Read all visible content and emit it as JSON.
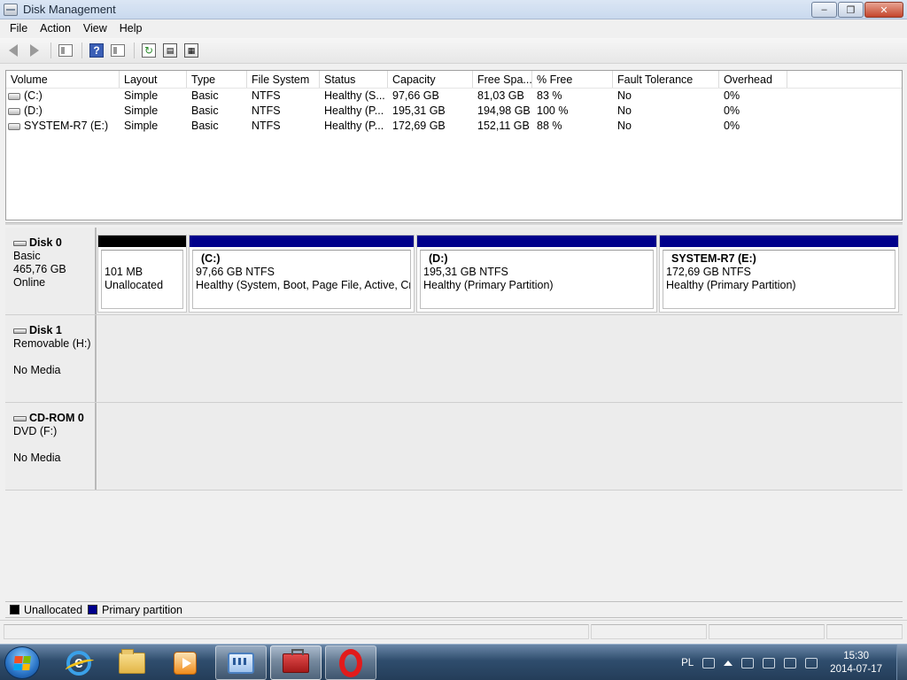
{
  "window": {
    "title": "Disk Management"
  },
  "menu": [
    "File",
    "Action",
    "View",
    "Help"
  ],
  "toolbar": {
    "icons": [
      "back-arrow-icon",
      "forward-arrow-icon",
      "console-tree-icon",
      "help-icon",
      "show-hide-pane-icon",
      "refresh-icon",
      "properties-icon",
      "rescan-icon"
    ]
  },
  "volume_table": {
    "columns": [
      "Volume",
      "Layout",
      "Type",
      "File System",
      "Status",
      "Capacity",
      "Free Spa...",
      "% Free",
      "Fault Tolerance",
      "Overhead"
    ],
    "rows": [
      [
        "(C:)",
        "Simple",
        "Basic",
        "NTFS",
        "Healthy (S...",
        "97,66 GB",
        "81,03 GB",
        "83 %",
        "No",
        "0%"
      ],
      [
        "(D:)",
        "Simple",
        "Basic",
        "NTFS",
        "Healthy (P...",
        "195,31 GB",
        "194,98 GB",
        "100 %",
        "No",
        "0%"
      ],
      [
        "SYSTEM-R7 (E:)",
        "Simple",
        "Basic",
        "NTFS",
        "Healthy (P...",
        "172,69 GB",
        "152,11 GB",
        "88 %",
        "No",
        "0%"
      ]
    ]
  },
  "disks": [
    {
      "name": "Disk 0",
      "line1": "Basic",
      "line2": "465,76 GB",
      "line3": "Online",
      "partitions": [
        {
          "name": "",
          "size": "101 MB",
          "status": "Unallocated",
          "kind": "unallocated"
        },
        {
          "name": "(C:)",
          "size": "97,66 GB NTFS",
          "status": "Healthy (System, Boot, Page File, Active, Crash",
          "kind": "primary"
        },
        {
          "name": "(D:)",
          "size": "195,31 GB NTFS",
          "status": "Healthy (Primary Partition)",
          "kind": "primary"
        },
        {
          "name": "SYSTEM-R7  (E:)",
          "size": "172,69 GB NTFS",
          "status": "Healthy (Primary Partition)",
          "kind": "primary"
        }
      ]
    },
    {
      "name": "Disk 1",
      "line1": "Removable (H:)",
      "line2": "",
      "line3": "No Media",
      "partitions": []
    },
    {
      "name": "CD-ROM 0",
      "line1": "DVD (F:)",
      "line2": "",
      "line3": "No Media",
      "partitions": []
    }
  ],
  "legend": [
    {
      "label": "Unallocated",
      "color": "#000000"
    },
    {
      "label": "Primary partition",
      "color": "#00008b"
    }
  ],
  "taskbar": {
    "apps": [
      "internet-explorer-icon",
      "windows-explorer-icon",
      "media-player-icon",
      "control-panel-icon",
      "toolbox-icon",
      "opera-icon"
    ],
    "language": "PL",
    "time": "15:30",
    "date": "2014-07-17"
  }
}
